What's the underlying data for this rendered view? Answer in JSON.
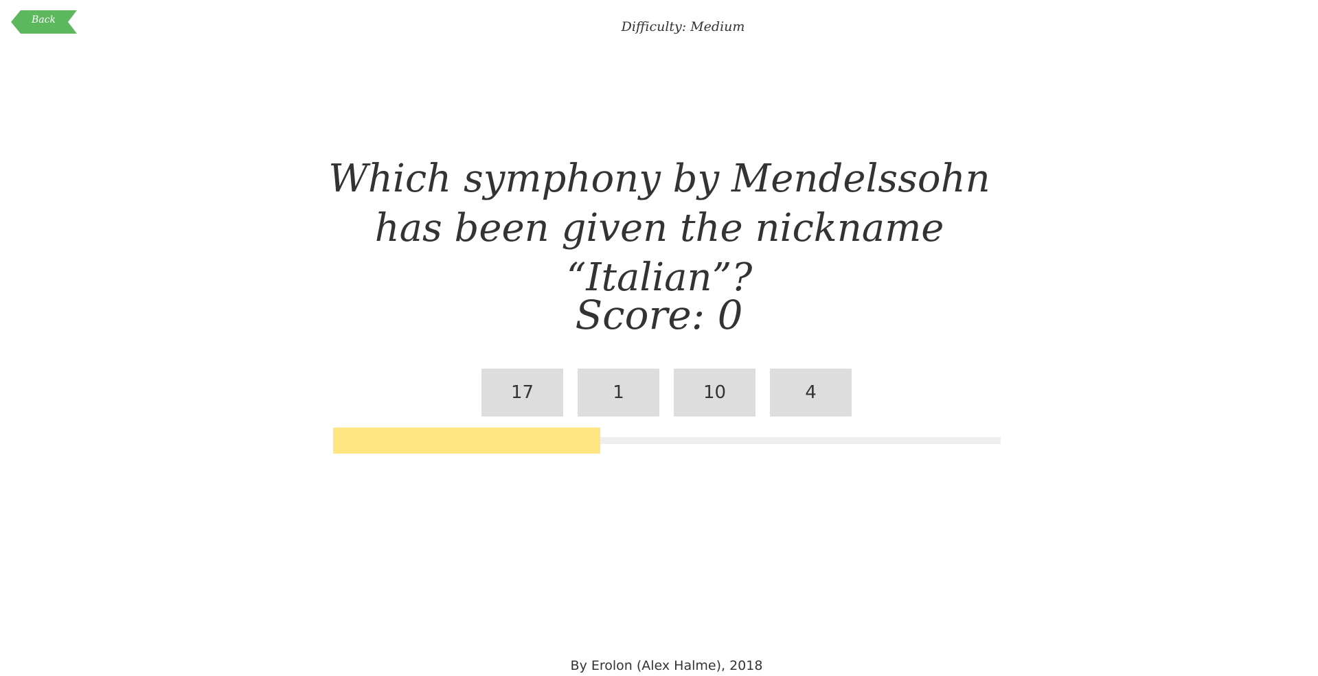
{
  "header": {
    "back_label": "Back",
    "difficulty_label": "Difficulty: Medium"
  },
  "quiz": {
    "question": "Which symphony by Mendelssohn has been given the nickname “Italian”?",
    "score_label": "Score: 0",
    "answers": [
      "17",
      "1",
      "10",
      "4"
    ],
    "progress_fraction": 0.4
  },
  "footer": {
    "credit": "By Erolon (Alex Halme), 2018"
  },
  "colors": {
    "back_button": "#5cb85c",
    "answer_bg": "#dddddd",
    "progress_fill": "#ffe680",
    "progress_track": "#eeeeee",
    "text": "#333333"
  }
}
